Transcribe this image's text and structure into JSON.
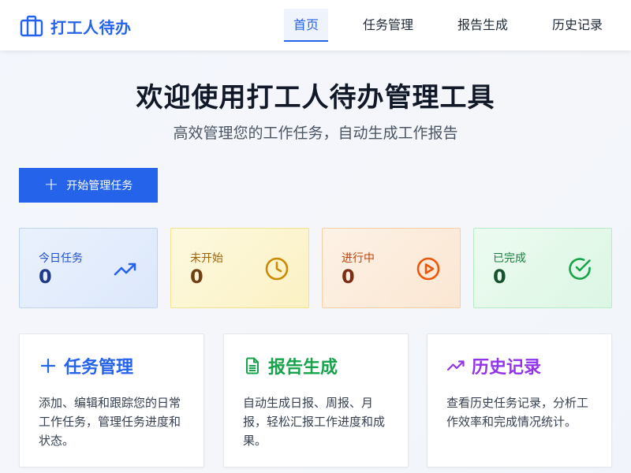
{
  "brand": {
    "name": "打工人待办",
    "icon": "briefcase-icon",
    "color": "#2563eb"
  },
  "nav": {
    "items": [
      {
        "label": "首页",
        "active": true
      },
      {
        "label": "任务管理",
        "active": false
      },
      {
        "label": "报告生成",
        "active": false
      },
      {
        "label": "历史记录",
        "active": false
      }
    ]
  },
  "hero": {
    "title": "欢迎使用打工人待办管理工具",
    "subtitle": "高效管理您的工作任务，自动生成工作报告",
    "cta_label": "开始管理任务",
    "cta_icon": "plus-icon",
    "cta_color": "#2563eb"
  },
  "stats": [
    {
      "label": "今日任务",
      "value": "0",
      "icon": "trending-up-icon",
      "color": "#2563eb"
    },
    {
      "label": "未开始",
      "value": "0",
      "icon": "clock-icon",
      "color": "#ca8a04"
    },
    {
      "label": "进行中",
      "value": "0",
      "icon": "play-circle-icon",
      "color": "#ea580c"
    },
    {
      "label": "已完成",
      "value": "0",
      "icon": "check-circle-icon",
      "color": "#16a34a"
    }
  ],
  "features": [
    {
      "title": "任务管理",
      "icon": "plus-icon",
      "description": "添加、编辑和跟踪您的日常工作任务，管理任务进度和状态。",
      "color": "#2563eb"
    },
    {
      "title": "报告生成",
      "icon": "document-icon",
      "description": "自动生成日报、周报、月报，轻松汇报工作进度和成果。",
      "color": "#16a34a"
    },
    {
      "title": "历史记录",
      "icon": "trending-up-icon",
      "description": "查看历史任务记录，分析工作效率和完成情况统计。",
      "color": "#9333ea"
    }
  ]
}
